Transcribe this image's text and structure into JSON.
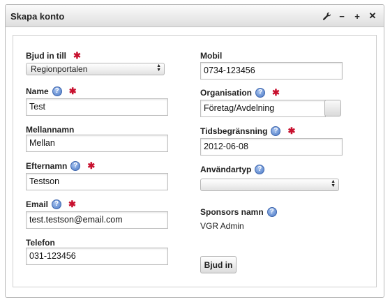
{
  "window": {
    "title": "Skapa konto",
    "tools": {
      "settings": "wrench-icon",
      "minimize": "−",
      "maximize": "+",
      "close": "✕"
    }
  },
  "form": {
    "bjud_in_till": {
      "label": "Bjud in till",
      "value": "Regionportalen"
    },
    "name": {
      "label": "Name",
      "value": "Test"
    },
    "mellannamn": {
      "label": "Mellannamn",
      "value": "Mellan"
    },
    "efternamn": {
      "label": "Efternamn",
      "value": "Testson"
    },
    "email": {
      "label": "Email",
      "value": "test.testson@email.com"
    },
    "telefon": {
      "label": "Telefon",
      "value": "031-123456"
    },
    "mobil": {
      "label": "Mobil",
      "value": "0734-123456"
    },
    "organisation": {
      "label": "Organisation",
      "value": "Företag/Avdelning"
    },
    "tidsbegransning": {
      "label": "Tidsbegränsning",
      "value": "2012-06-08"
    },
    "anvandartyp": {
      "label": "Användartyp",
      "value": ""
    },
    "sponsors_namn": {
      "label": "Sponsors namn",
      "value": "VGR Admin"
    },
    "submit_label": "Bjud in"
  },
  "colors": {
    "required": "#c8102e",
    "help": "#4a79c7"
  }
}
